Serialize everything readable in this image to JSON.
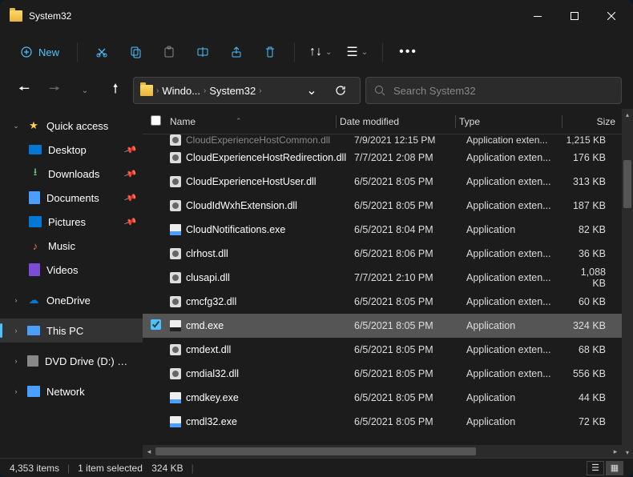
{
  "title": "System32",
  "toolbar": {
    "new_label": "New"
  },
  "breadcrumb": {
    "items": [
      "Windo...",
      "System32"
    ],
    "dropdown": "⌄"
  },
  "search": {
    "placeholder": "Search System32"
  },
  "columns": {
    "name": "Name",
    "date": "Date modified",
    "type": "Type",
    "size": "Size"
  },
  "sidebar": {
    "quick_access": "Quick access",
    "items": [
      {
        "label": "Desktop",
        "icon": "desktop",
        "pinned": true
      },
      {
        "label": "Downloads",
        "icon": "download",
        "pinned": true
      },
      {
        "label": "Documents",
        "icon": "docs",
        "pinned": true
      },
      {
        "label": "Pictures",
        "icon": "pics",
        "pinned": true
      },
      {
        "label": "Music",
        "icon": "music",
        "pinned": false
      },
      {
        "label": "Videos",
        "icon": "video",
        "pinned": false
      }
    ],
    "onedrive": "OneDrive",
    "this_pc": "This PC",
    "dvd": "DVD Drive (D:) CCCO",
    "network": "Network"
  },
  "files": [
    {
      "name": "CloudExperienceHostCommon.dll",
      "date": "7/9/2021 12:15 PM",
      "type": "Application exten...",
      "size": "1,215 KB",
      "icon": "dll",
      "partial": true
    },
    {
      "name": "CloudExperienceHostRedirection.dll",
      "date": "7/7/2021 2:08 PM",
      "type": "Application exten...",
      "size": "176 KB",
      "icon": "dll"
    },
    {
      "name": "CloudExperienceHostUser.dll",
      "date": "6/5/2021 8:05 PM",
      "type": "Application exten...",
      "size": "313 KB",
      "icon": "dll"
    },
    {
      "name": "CloudIdWxhExtension.dll",
      "date": "6/5/2021 8:05 PM",
      "type": "Application exten...",
      "size": "187 KB",
      "icon": "dll"
    },
    {
      "name": "CloudNotifications.exe",
      "date": "6/5/2021 8:04 PM",
      "type": "Application",
      "size": "82 KB",
      "icon": "exe"
    },
    {
      "name": "clrhost.dll",
      "date": "6/5/2021 8:06 PM",
      "type": "Application exten...",
      "size": "36 KB",
      "icon": "dll"
    },
    {
      "name": "clusapi.dll",
      "date": "7/7/2021 2:10 PM",
      "type": "Application exten...",
      "size": "1,088 KB",
      "icon": "dll"
    },
    {
      "name": "cmcfg32.dll",
      "date": "6/5/2021 8:05 PM",
      "type": "Application exten...",
      "size": "60 KB",
      "icon": "dll"
    },
    {
      "name": "cmd.exe",
      "date": "6/5/2021 8:05 PM",
      "type": "Application",
      "size": "324 KB",
      "icon": "cmd",
      "selected": true
    },
    {
      "name": "cmdext.dll",
      "date": "6/5/2021 8:05 PM",
      "type": "Application exten...",
      "size": "68 KB",
      "icon": "dll"
    },
    {
      "name": "cmdial32.dll",
      "date": "6/5/2021 8:05 PM",
      "type": "Application exten...",
      "size": "556 KB",
      "icon": "dll"
    },
    {
      "name": "cmdkey.exe",
      "date": "6/5/2021 8:05 PM",
      "type": "Application",
      "size": "44 KB",
      "icon": "exe"
    },
    {
      "name": "cmdl32.exe",
      "date": "6/5/2021 8:05 PM",
      "type": "Application",
      "size": "72 KB",
      "icon": "exe"
    }
  ],
  "status": {
    "count": "4,353 items",
    "selection": "1 item selected",
    "size": "324 KB"
  }
}
